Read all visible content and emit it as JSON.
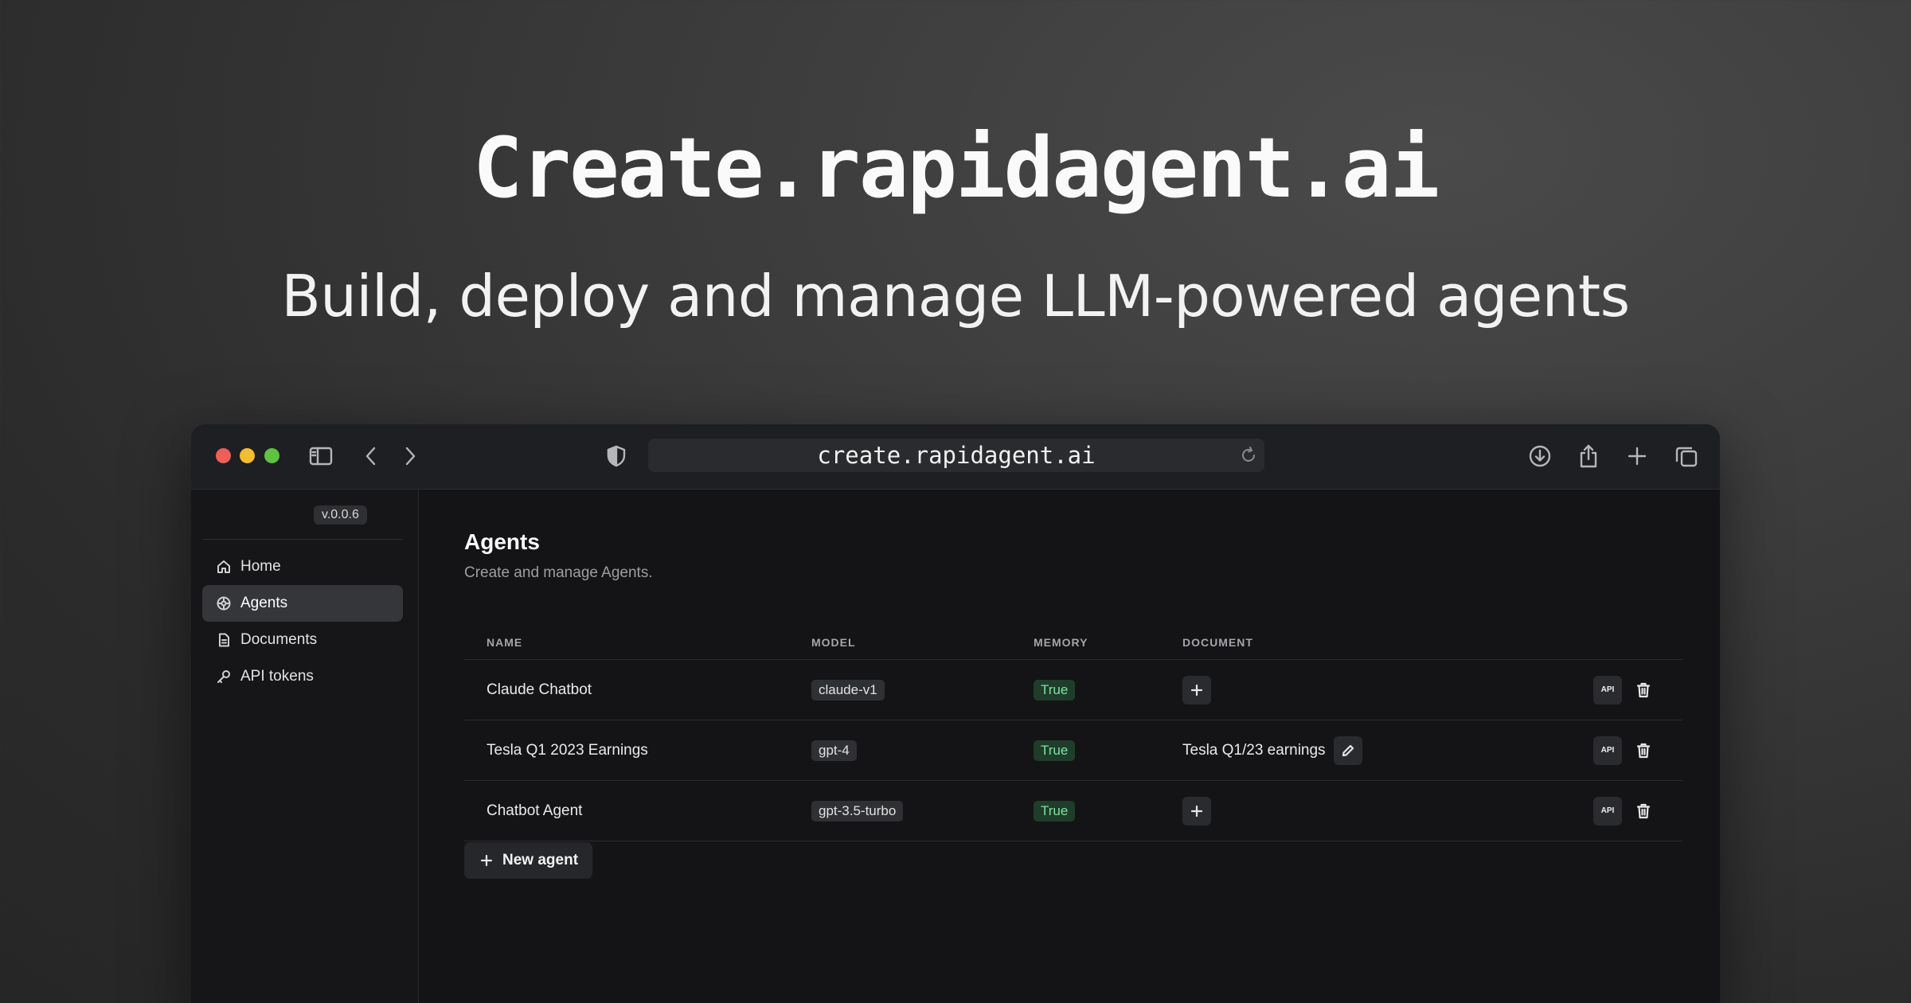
{
  "hero": {
    "title": "Create.rapidagent.ai",
    "subtitle": "Build, deploy and manage LLM-powered agents"
  },
  "browser": {
    "url": "create.rapidagent.ai",
    "icons": [
      "sidebar-toggle-icon",
      "back-icon",
      "forward-icon",
      "shield-icon",
      "reload-icon",
      "download-icon",
      "share-icon",
      "new-tab-icon",
      "tabs-overview-icon"
    ]
  },
  "sidebar": {
    "version": "v.0.0.6",
    "items": [
      {
        "label": "Home",
        "icon": "home-icon",
        "active": false
      },
      {
        "label": "Agents",
        "icon": "agents-icon",
        "active": true
      },
      {
        "label": "Documents",
        "icon": "document-icon",
        "active": false
      },
      {
        "label": "API tokens",
        "icon": "key-icon",
        "active": false
      }
    ]
  },
  "main": {
    "title": "Agents",
    "description": "Create and manage Agents.",
    "columns": [
      "NAME",
      "MODEL",
      "MEMORY",
      "DOCUMENT"
    ],
    "rows": [
      {
        "name": "Claude Chatbot",
        "model": "claude-v1",
        "memory": "True",
        "document": ""
      },
      {
        "name": "Tesla Q1 2023 Earnings",
        "model": "gpt-4",
        "memory": "True",
        "document": "Tesla Q1/23 earnings"
      },
      {
        "name": "Chatbot Agent",
        "model": "gpt-3.5-turbo",
        "memory": "True",
        "document": ""
      }
    ],
    "api_label": "API",
    "new_agent_label": "New agent"
  },
  "colors": {
    "memory_badge_bg": "#1f3d2a",
    "memory_badge_text": "#7ee2a0",
    "traffic_red": "#ed5f58",
    "traffic_yellow": "#f4bc2f",
    "traffic_green": "#5fc241"
  }
}
